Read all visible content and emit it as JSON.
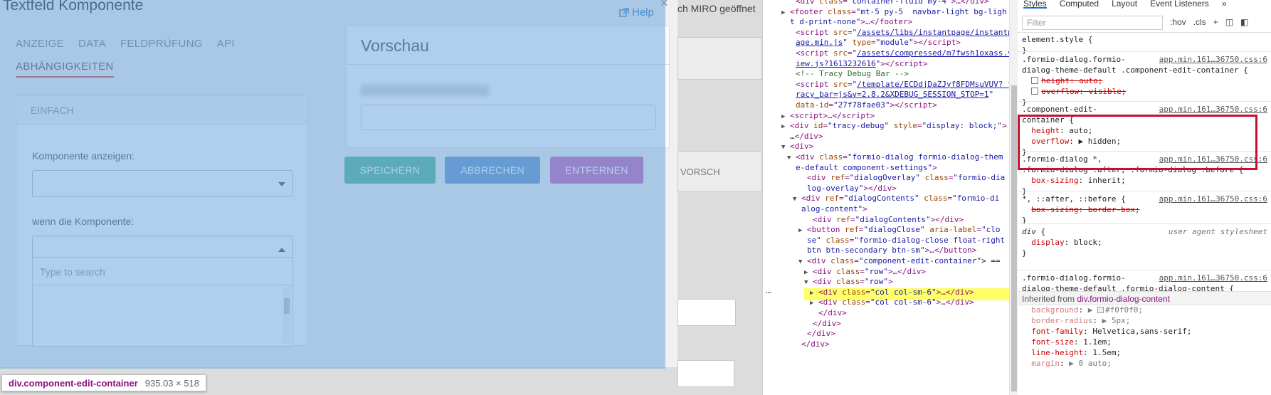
{
  "page": {
    "bg_text_right": "ch MIRO geöffnet",
    "bg_text_preview": "VORSCH"
  },
  "dialog": {
    "title": "Textfeld Komponente",
    "help": "Help",
    "close": "×",
    "tabs": [
      "ANZEIGE",
      "DATA",
      "FELDPRÜFUNG",
      "API"
    ],
    "active_tab": "ABHÄNGIGKEITEN",
    "panel_title": "EINFACH",
    "field1_label": "Komponente anzeigen:",
    "field2_label": "wenn die Komponente:",
    "search_placeholder": "Type to search",
    "preview_title": "Vorschau",
    "buttons": {
      "save": "SPEICHERN",
      "cancel": "ABBRECHEN",
      "remove": "ENTFERNEN"
    },
    "colors": {
      "overlay": "#6fa8dc",
      "save": "#44b08c",
      "cancel": "#5b8dc7",
      "remove": "#c659b4",
      "tab_underline": "#d9435a"
    }
  },
  "size_tooltip": {
    "element": "div.component-edit-container",
    "size": "935.03 × 518"
  },
  "elements_panel": {
    "lines": [
      {
        "indent": 3,
        "tri": "",
        "html": "<span class='t'>&lt;div</span> <span class='a'>class</span>=<span class='v'>\"container-fluid my-4\"</span><span class='t'>&gt;…&lt;/div&gt;</span>"
      },
      {
        "indent": 2,
        "tri": "▶",
        "html": "<span class='t'>&lt;footer</span> <span class='a'>class</span>=<span class='v'>\"mt-5 py-5  navbar-light bg-ligh</span>"
      },
      {
        "indent": 2,
        "tri": "",
        "html": "<span class='v'>t d-print-none\"</span><span class='t'>&gt;…&lt;/footer&gt;</span>"
      },
      {
        "indent": 3,
        "tri": "",
        "html": "<span class='t'>&lt;script</span> <span class='a'>src</span>=<span class='v'>\"</span><span class='lk'>/assets/libs/instantpage/instantp</span>"
      },
      {
        "indent": 3,
        "tri": "",
        "html": "<span class='lk'>age.min.js</span><span class='v'>\"</span> <span class='a'>type</span>=<span class='v'>\"module\"</span><span class='t'>&gt;&lt;/script&gt;</span>"
      },
      {
        "indent": 3,
        "tri": "",
        "html": "<span class='t'>&lt;script</span> <span class='a'>src</span>=<span class='v'>\"</span><span class='lk'>/assets/compressed/m7fwsh1oxass.v</span>"
      },
      {
        "indent": 3,
        "tri": "",
        "html": "<span class='lk'>iew.js?1613232616</span><span class='v'>\"</span><span class='t'>&gt;&lt;/script&gt;</span>"
      },
      {
        "indent": 3,
        "tri": "",
        "html": "<span class='cm'>&lt;!-- Tracy Debug Bar --&gt;</span>"
      },
      {
        "indent": 3,
        "tri": "",
        "html": "<span class='t'>&lt;script</span> <span class='a'>src</span>=<span class='v'>\"</span><span class='lk'>/template/ECDdjDaZJyf8FDMsuVUV? t</span>"
      },
      {
        "indent": 3,
        "tri": "",
        "html": "<span class='lk'>racy_bar=js&amp;v=2.8.2&amp;XDEBUG_SESSION_STOP=1</span><span class='v'>\"</span>"
      },
      {
        "indent": 3,
        "tri": "",
        "html": "<span class='a'>data-id</span>=<span class='v'>\"27f78fae03\"</span><span class='t'>&gt;&lt;/script&gt;</span>"
      },
      {
        "indent": 2,
        "tri": "▶",
        "html": "<span class='t'>&lt;script&gt;…&lt;/script&gt;</span>"
      },
      {
        "indent": 2,
        "tri": "▶",
        "html": "<span class='t'>&lt;div</span> <span class='a'>id</span>=<span class='v'>\"tracy-debug\"</span> <span class='a'>style</span>=<span class='v'>\"display: block;\"</span><span class='t'>&gt;</span>"
      },
      {
        "indent": 2,
        "tri": "",
        "html": "<span class='tx'>…</span><span class='t'>&lt;/div&gt;</span>"
      },
      {
        "indent": 2,
        "tri": "▼",
        "html": "<span class='t'>&lt;div&gt;</span>"
      },
      {
        "indent": 3,
        "tri": "▼",
        "html": "<span class='t'>&lt;div</span> <span class='a'>class</span>=<span class='v'>\"formio-dialog formio-dialog-them</span>"
      },
      {
        "indent": 3,
        "tri": "",
        "html": "<span class='v'>e-default component-settings\"</span><span class='t'>&gt;</span>"
      },
      {
        "indent": 5,
        "tri": "",
        "html": "<span class='t'>&lt;div</span> <span class='a'>ref</span>=<span class='v'>\"dialogOverlay\"</span> <span class='a'>class</span>=<span class='v'>\"formio-dia</span>"
      },
      {
        "indent": 5,
        "tri": "",
        "html": "<span class='v'>log-overlay\"</span><span class='t'>&gt;&lt;/div&gt;</span>"
      },
      {
        "indent": 4,
        "tri": "▼",
        "html": "<span class='t'>&lt;div</span> <span class='a'>ref</span>=<span class='v'>\"dialogContents\"</span> <span class='a'>class</span>=<span class='v'>\"formio-di</span>"
      },
      {
        "indent": 4,
        "tri": "",
        "html": "<span class='v'>alog-content\"</span><span class='t'>&gt;</span>"
      },
      {
        "indent": 6,
        "tri": "",
        "html": "<span class='t'>&lt;div</span> <span class='a'>ref</span>=<span class='v'>\"dialogContents\"</span><span class='t'>&gt;&lt;/div&gt;</span>"
      },
      {
        "indent": 5,
        "tri": "▶",
        "html": "<span class='t'>&lt;button</span> <span class='a'>ref</span>=<span class='v'>\"dialogClose\"</span> <span class='a'>aria-label</span>=<span class='v'>\"clo</span>"
      },
      {
        "indent": 5,
        "tri": "",
        "html": "<span class='v'>se\"</span> <span class='a'>class</span>=<span class='v'>\"formio-dialog-close float-right</span>"
      },
      {
        "indent": 5,
        "tri": "",
        "html": "<span class='v'>btn btn-secondary btn-sm\"</span><span class='t'>&gt;…&lt;/button&gt;</span>"
      },
      {
        "indent": 5,
        "tri": "▼",
        "html": "<span class='t'>&lt;div</span> <span class='a'>class</span>=<span class='v'>\"component-edit-container\"</span><span class='tx'>&gt; ==</span>"
      },
      {
        "indent": 6,
        "tri": "▶",
        "html": "<span class='t'>&lt;div</span> <span class='a'>class</span>=<span class='v'>\"row\"</span><span class='t'>&gt;…&lt;/div&gt;</span>"
      },
      {
        "indent": 6,
        "tri": "▼",
        "html": "<span class='t'>&lt;div</span> <span class='a'>class</span>=<span class='v'>\"row\"</span><span class='t'>&gt;</span>"
      },
      {
        "indent": 7,
        "tri": "▶",
        "html": "<span class='t'>&lt;div</span> <span class='a'>class</span>=<span class='v'>\"col col-sm-6\"</span><span class='t'>&gt;…&lt;/div&gt;</span>"
      },
      {
        "indent": 7,
        "tri": "▶",
        "html": "<span class='t'>&lt;div</span> <span class='a'>class</span>=<span class='v'>\"col col-sm-6\"</span><span class='t'>&gt;…&lt;/div&gt;</span>"
      },
      {
        "indent": 7,
        "tri": "",
        "html": "<span class='t'>&lt;/div&gt;</span>"
      },
      {
        "indent": 6,
        "tri": "",
        "html": "<span class='t'>&lt;/div&gt;</span>"
      },
      {
        "indent": 5,
        "tri": "",
        "html": "<span class='t'>&lt;/div&gt;</span>"
      },
      {
        "indent": 4,
        "tri": "",
        "html": "<span class='t'>&lt;/div&gt;</span>"
      }
    ]
  },
  "styles_panel": {
    "tabs": [
      "Styles",
      "Computed",
      "Layout",
      "Event Listeners",
      "»"
    ],
    "filter_placeholder": "Filter",
    "filter_tools": [
      ":hov",
      ".cls",
      "+"
    ],
    "rules": [
      {
        "html": "element.style {\n}"
      },
      {
        "html": ".formio-dialog.formio-\ndialog-theme-default .component-edit-container {\n  <span class='cb'></span><span class='prop strike'>height: auto;</span>\n  <span class='cb'></span><span class='prop strike'>overflow: visible;</span>\n}",
        "src": "app.min.161…36750.css:6"
      },
      {
        "html": ".component-edit-\ncontainer {\n  <span class='prop'>height</span>: <span class='val'>auto;</span>\n  <span class='prop'>overflow</span>: ▶ <span class='val'>hidden;</span>\n}",
        "src": "app.min.161…36750.css:6"
      },
      {
        "html": ".formio-dialog *,\n.formio-dialog :after, .formio-dialog :before {\n  <span class='prop'>box-sizing</span>: <span class='val'>inherit;</span>\n}",
        "src": "app.min.161…36750.css:6"
      },
      {
        "html": "*, ::after, ::before {\n  <span class='prop strike'>box-sizing: border-box;</span>\n}",
        "src": "app.min.161…36750.css:6"
      },
      {
        "html": "<i>div</i> {\n  <span class='prop'>display</span>: <span class='val'>block;</span>\n}",
        "ua": "user agent stylesheet"
      },
      {
        "html": ".formio-dialog.formio-\ndialog-theme-default .formio-dialog-content {\n  <span class='dim-prop'>animation</span>: <span class='dim-val'>▶ formio-dialog-flyin .5s;</span>\n  <span class='dim-prop'>background</span>: <span class='dim-val'>▶ <span class='swatch'></span>#f0f0f0;</span>\n  <span class='dim-prop'>border-radius</span>: <span class='dim-val'>▶ 5px;</span>\n  <span class='prop'>font-family</span>: <span class='val'>Helvetica,sans-serif;</span>\n  <span class='prop'>font-size</span>: <span class='val'>1.1em;</span>\n  <span class='prop'>line-height</span>: <span class='val'>1.5em;</span>\n  <span class='dim-prop'>margin</span>: <span class='dim-val'>▶ 0 auto;</span>",
        "src": "app.min.161…36750.css:6"
      }
    ],
    "inherited_label": "Inherited from",
    "inherited_from": "div.formio-dialog-content"
  }
}
